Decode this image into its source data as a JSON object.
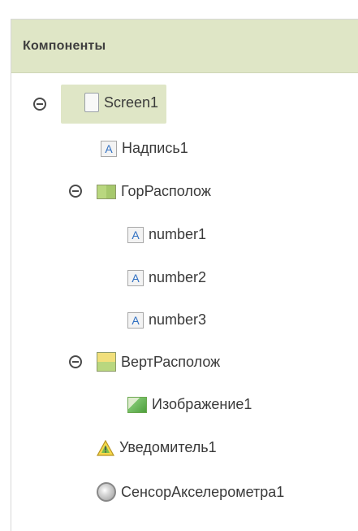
{
  "panel": {
    "title": "Компоненты",
    "header_bg": "#dfe6c6",
    "selected_bg": "#dfe6c6"
  },
  "tree": {
    "screen": {
      "label": "Screen1",
      "icon": "screen-icon",
      "collapsed": false
    },
    "children": [
      {
        "label": "Надпись1",
        "icon": "label-icon",
        "collapsed": null
      },
      {
        "label": "ГорРасполож",
        "icon": "horizontal-arrangement-icon",
        "collapsed": false,
        "children": [
          {
            "label": "number1",
            "icon": "label-icon"
          },
          {
            "label": "number2",
            "icon": "label-icon"
          },
          {
            "label": "number3",
            "icon": "label-icon"
          }
        ]
      },
      {
        "label": "ВертРасполож",
        "icon": "vertical-arrangement-icon",
        "collapsed": false,
        "children": [
          {
            "label": "Изображение1",
            "icon": "image-icon"
          }
        ]
      },
      {
        "label": "Уведомитель1",
        "icon": "notifier-icon",
        "collapsed": null
      },
      {
        "label": "СенсорАкселерометра1",
        "icon": "accelerometer-icon",
        "collapsed": null
      }
    ]
  },
  "icons": {
    "collapse_toggle": "minus-circle-icon",
    "label_glyph": "A"
  }
}
